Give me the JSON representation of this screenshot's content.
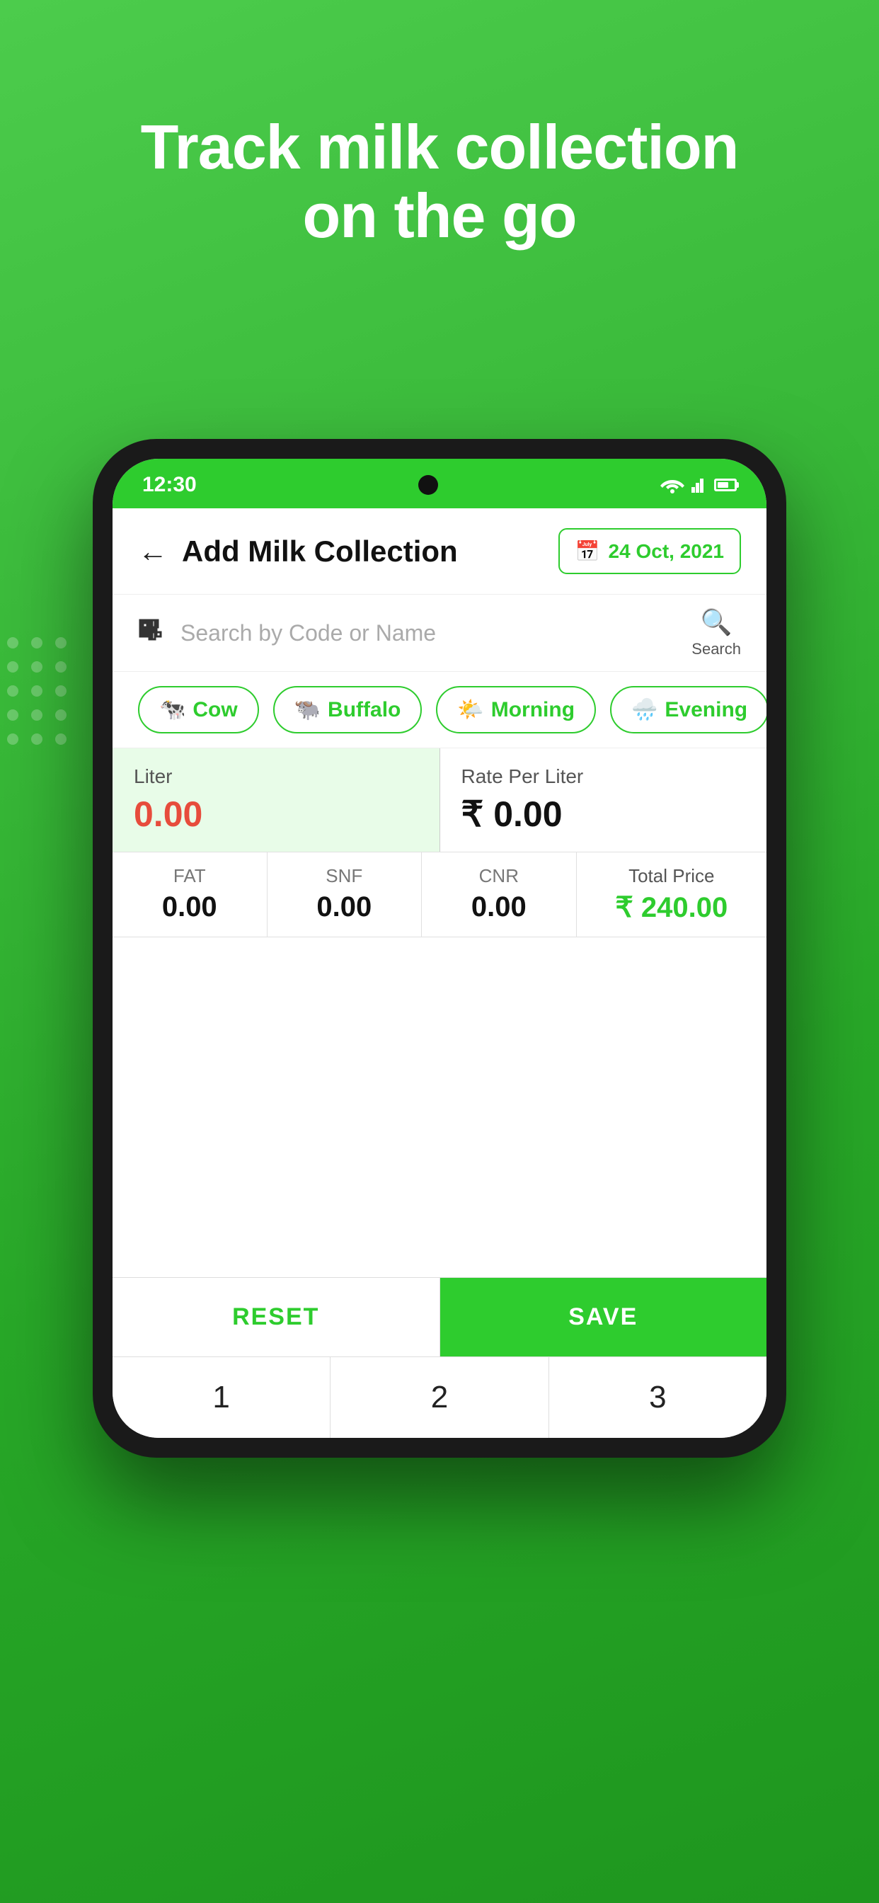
{
  "hero": {
    "title_line1": "Track milk collection",
    "title_line2": "on the go"
  },
  "status_bar": {
    "time": "12:30",
    "wifi_icon": "wifi-icon",
    "signal_icon": "signal-icon",
    "battery_icon": "battery-icon"
  },
  "header": {
    "back_label": "←",
    "title": "Add Milk Collection",
    "date": "24 Oct, 2021",
    "calendar_icon": "calendar-icon"
  },
  "search": {
    "barcode_icon": "barcode-icon",
    "placeholder": "Search by Code or Name",
    "search_icon": "search-icon",
    "search_label": "Search"
  },
  "filters": [
    {
      "id": "cow",
      "emoji": "🐄",
      "label": "Cow"
    },
    {
      "id": "buffalo",
      "emoji": "🐃",
      "label": "Buffalo"
    },
    {
      "id": "morning",
      "emoji": "🌤️",
      "label": "Morning"
    },
    {
      "id": "evening",
      "emoji": "🌧️",
      "label": "Evening"
    }
  ],
  "entry": {
    "liter_label": "Liter",
    "liter_value": "0.00",
    "rate_label": "Rate Per Liter",
    "rate_value": "₹ 0.00"
  },
  "metrics": {
    "fat_label": "FAT",
    "fat_value": "0.00",
    "snf_label": "SNF",
    "snf_value": "0.00",
    "cnr_label": "CNR",
    "cnr_value": "0.00",
    "total_label": "Total Price",
    "total_value": "₹ 240.00"
  },
  "buttons": {
    "reset_label": "RESET",
    "save_label": "SAVE"
  },
  "keypad": {
    "keys": [
      "1",
      "2",
      "3"
    ]
  }
}
